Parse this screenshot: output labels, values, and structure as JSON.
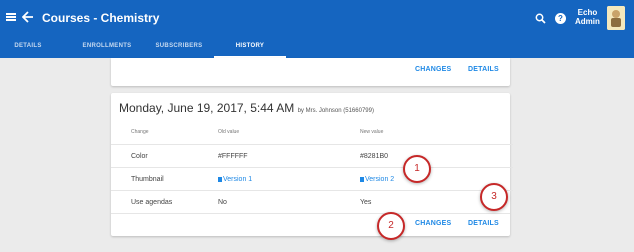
{
  "appbar": {
    "title": "Courses - Chemistry",
    "menu_icon": "hamburger-icon",
    "back_icon": "back-arrow-icon",
    "search_icon": "search-icon",
    "help_icon": "help-icon",
    "help_glyph": "?",
    "user": {
      "line1": "Echo",
      "line2": "Admin"
    },
    "bg_color": "#1565c0"
  },
  "tabs": [
    {
      "label": "DETAILS"
    },
    {
      "label": "ENROLLMENTS"
    },
    {
      "label": "SUBSCRIBERS"
    },
    {
      "label": "HISTORY",
      "active": true
    }
  ],
  "prev_card": {
    "changes_label": "CHANGES",
    "details_label": "DETAILS"
  },
  "entry": {
    "date": "Monday, June 19, 2017, 5:44 AM",
    "by": "by Mrs. Johnson (51660799)",
    "columns": [
      "Change",
      "Old value",
      "New value"
    ],
    "rows": [
      {
        "change": "Color",
        "old": "#FFFFFF",
        "new": "#8281B0"
      },
      {
        "change": "Thumbnail",
        "old": "Version 1",
        "new": "Version 2"
      },
      {
        "change": "Use agendas",
        "old": "No",
        "new": "Yes"
      }
    ],
    "changes_label": "CHANGES",
    "details_label": "DETAILS"
  },
  "callouts": [
    "1",
    "2",
    "3"
  ],
  "accent_color": "#1e88e5",
  "callout_color": "#c62828"
}
